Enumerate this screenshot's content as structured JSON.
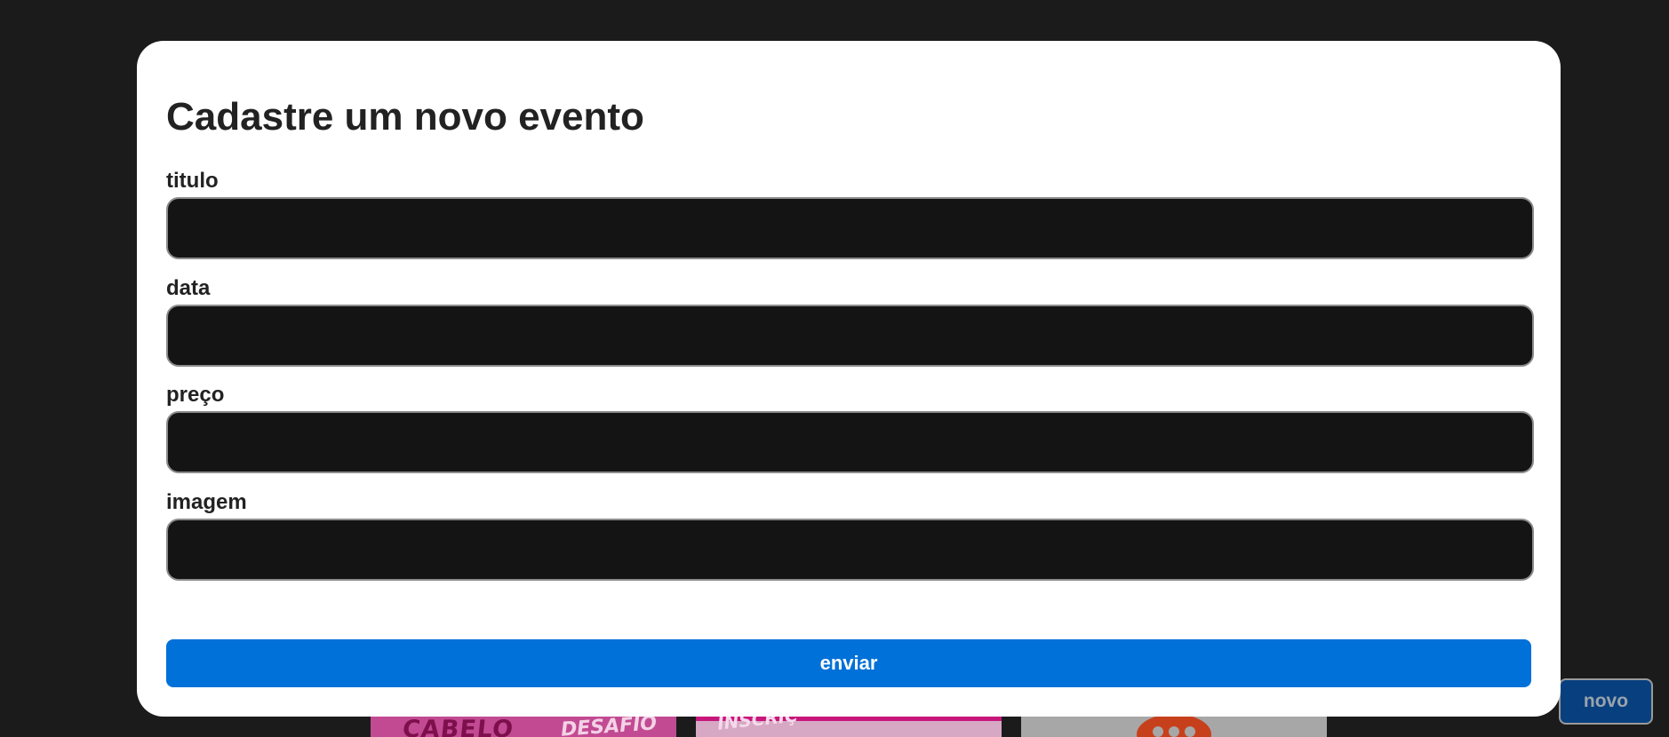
{
  "background": {
    "cards": [
      {
        "texts": [
          "CABELO",
          "DESAFIO"
        ]
      },
      {
        "texts": [
          "INSCRIÇ"
        ]
      },
      {
        "texts": []
      }
    ]
  },
  "novo_button": {
    "label": "novo"
  },
  "modal": {
    "title": "Cadastre um novo evento",
    "fields": [
      {
        "label": "titulo",
        "value": "",
        "placeholder": ""
      },
      {
        "label": "data",
        "value": "",
        "placeholder": ""
      },
      {
        "label": "preço",
        "value": "",
        "placeholder": ""
      },
      {
        "label": "imagem",
        "value": "",
        "placeholder": ""
      }
    ],
    "submit_label": "enviar"
  },
  "colors": {
    "page_background": "#1b1b1b",
    "modal_background": "#ffffff",
    "input_background": "#141414",
    "submit_button": "#0071d8",
    "novo_button": "#08407f"
  }
}
